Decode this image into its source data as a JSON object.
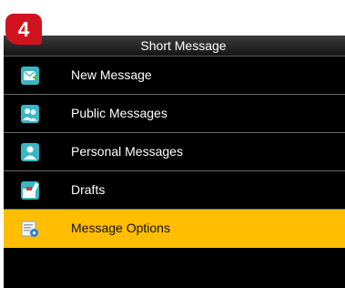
{
  "step_badge": "4",
  "title": "Short Message",
  "menu": {
    "items": [
      {
        "label": "New Message",
        "icon": "new-message-icon"
      },
      {
        "label": "Public Messages",
        "icon": "public-messages-icon"
      },
      {
        "label": "Personal Messages",
        "icon": "personal-messages-icon"
      },
      {
        "label": "Drafts",
        "icon": "drafts-icon"
      },
      {
        "label": "Message Options",
        "icon": "message-options-icon",
        "selected": true
      }
    ]
  },
  "colors": {
    "screen_background": "#000000",
    "selection_highlight": "#ffbe00",
    "badge": "#d0131c"
  }
}
